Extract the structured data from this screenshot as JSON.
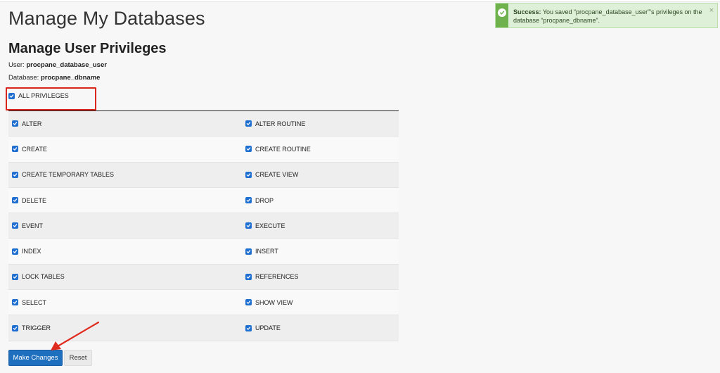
{
  "page": {
    "title": "Manage My Databases"
  },
  "section": {
    "title": "Manage User Privileges"
  },
  "meta": {
    "user_label": "User:",
    "user_value": "procpane_database_user",
    "db_label": "Database:",
    "db_value": "procpane_dbname"
  },
  "all_privileges": {
    "label": "ALL PRIVILEGES",
    "checked": true
  },
  "privileges": [
    {
      "left": "ALTER",
      "right": "ALTER ROUTINE"
    },
    {
      "left": "CREATE",
      "right": "CREATE ROUTINE"
    },
    {
      "left": "CREATE TEMPORARY TABLES",
      "right": "CREATE VIEW"
    },
    {
      "left": "DELETE",
      "right": "DROP"
    },
    {
      "left": "EVENT",
      "right": "EXECUTE"
    },
    {
      "left": "INDEX",
      "right": "INSERT"
    },
    {
      "left": "LOCK TABLES",
      "right": "REFERENCES"
    },
    {
      "left": "SELECT",
      "right": "SHOW VIEW"
    },
    {
      "left": "TRIGGER",
      "right": "UPDATE"
    }
  ],
  "buttons": {
    "make_changes": "Make Changes",
    "reset": "Reset"
  },
  "toast": {
    "strong": "Success:",
    "message": "You saved “procpane_database_user”’s privileges on the database “procpane_dbname”.",
    "close": "×",
    "icon": "check-circle-icon"
  },
  "colors": {
    "accent": "#1f6fbf",
    "checkbox": "#1f6fd1",
    "highlight": "#d9261c",
    "success_bg": "#dff0d8",
    "success_icon": "#6fb24d"
  }
}
